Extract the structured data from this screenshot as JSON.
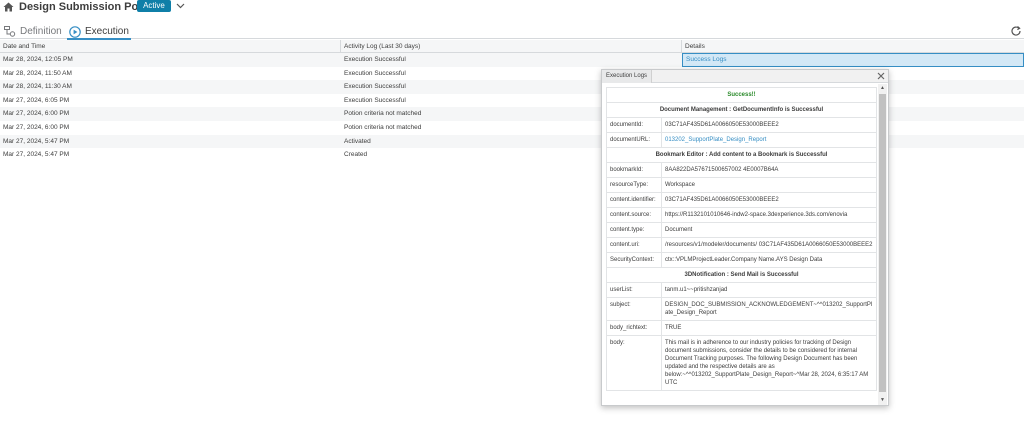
{
  "header": {
    "title": "Design Submission Potion",
    "status": "Active"
  },
  "tabs": [
    {
      "label": "Definition"
    },
    {
      "label": "Execution"
    }
  ],
  "grid": {
    "columns": [
      "Date and Time",
      "Activity Log (Last 30 days)",
      "Details"
    ],
    "rows": [
      {
        "date": "Mar 28, 2024, 12:05 PM",
        "activity": "Execution Successful",
        "details": "Success Logs"
      },
      {
        "date": "Mar 28, 2024, 11:50 AM",
        "activity": "Execution Successful",
        "details": ""
      },
      {
        "date": "Mar 28, 2024, 11:30 AM",
        "activity": "Execution Successful",
        "details": ""
      },
      {
        "date": "Mar 27, 2024, 6:05 PM",
        "activity": "Execution Successful",
        "details": ""
      },
      {
        "date": "Mar 27, 2024, 6:00 PM",
        "activity": "Potion criteria not matched",
        "details": ""
      },
      {
        "date": "Mar 27, 2024, 6:00 PM",
        "activity": "Potion criteria not matched",
        "details": ""
      },
      {
        "date": "Mar 27, 2024, 5:47 PM",
        "activity": "Activated",
        "details": ""
      },
      {
        "date": "Mar 27, 2024, 5:47 PM",
        "activity": "Created",
        "details": ""
      }
    ]
  },
  "dialog": {
    "title": "Execution Logs",
    "success": "Success!!",
    "sections": [
      {
        "heading": "Document Management : GetDocumentInfo is Successful",
        "fields": [
          {
            "label": "documentId:",
            "value": "03C71AF435D61A0066050E53000BEEE2"
          },
          {
            "label": "documentURL:",
            "value": "013202_SupportPlate_Design_Report"
          }
        ]
      },
      {
        "heading": "Bookmark Editor : Add content to a Bookmark is Successful",
        "fields": [
          {
            "label": "bookmarkId:",
            "value": "8AA822DA57671500657002 4E0007B64A"
          },
          {
            "label": "resourceType:",
            "value": "Workspace"
          },
          {
            "label": "content.identifier:",
            "value": "03C71AF435D61A0066050E53000BEEE2"
          },
          {
            "label": "content.source:",
            "value": "https://R1132101010646-indw2-space.3dexperience.3ds.com/enovia"
          },
          {
            "label": "content.type:",
            "value": "Document"
          },
          {
            "label": "content.uri:",
            "value": "/resources/v1/modeler/documents/ 03C71AF435D61A0066050E53000BEEE2"
          },
          {
            "label": "SecurityContext:",
            "value": "ctx::VPLMProjectLeader.Company Name.AYS Design Data"
          }
        ]
      },
      {
        "heading": "3DNotification : Send Mail is Successful",
        "fields": [
          {
            "label": "userList:",
            "value": "tanm.u1~~pritishzanjad"
          },
          {
            "label": "subject:",
            "value": "DESIGN_DOC_SUBMISSION_ACKNOWLEDGEMENT~^^013202_SupportPlate_Design_Report"
          },
          {
            "label": "body_richtext:",
            "value": "TRUE"
          },
          {
            "label": "body:",
            "value": "This mail is in adherence to our industry policies for tracking of Design document submissions, consider the details to be considered for internal Document Tracking purposes. The following Design Document has been updated and the respective details are as below:~^^013202_SupportPlate_Design_Report~^Mar 28, 2024, 6:35:17 AM UTC"
          }
        ]
      }
    ]
  },
  "colors": {
    "accent": "#368ec4",
    "badge": "#0f7fa8",
    "success": "#2a8a2a"
  }
}
